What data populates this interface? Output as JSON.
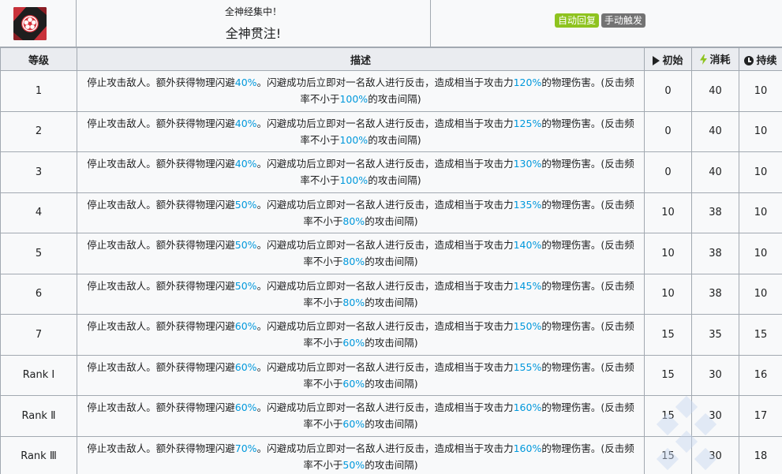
{
  "skill": {
    "icon": "skill-icon",
    "subtitle": "全神经集中！",
    "title": "全神贯注!",
    "tags": [
      {
        "label": "自动回复",
        "color": "#8ec31f"
      },
      {
        "label": "手动触发",
        "color": "#737373"
      }
    ]
  },
  "table": {
    "headers": {
      "level": "等级",
      "description": "描述",
      "initial": "初始",
      "cost": "消耗",
      "duration": "持续"
    },
    "desc_parts": {
      "a": "停止攻击敌人。额外获得物理闪避",
      "b": "。闪避成功后立即对一名敌人进行反击，造成相当于攻击力",
      "c": "的物理伤害。(反击频率不小于",
      "d": "的攻击间隔)"
    },
    "rows": [
      {
        "level": "1",
        "dodge": "40%",
        "atk": "120%",
        "freq": "100%",
        "initial": "0",
        "cost": "40",
        "duration": "10"
      },
      {
        "level": "2",
        "dodge": "40%",
        "atk": "125%",
        "freq": "100%",
        "initial": "0",
        "cost": "40",
        "duration": "10"
      },
      {
        "level": "3",
        "dodge": "40%",
        "atk": "130%",
        "freq": "100%",
        "initial": "0",
        "cost": "40",
        "duration": "10"
      },
      {
        "level": "4",
        "dodge": "50%",
        "atk": "135%",
        "freq": "80%",
        "initial": "10",
        "cost": "38",
        "duration": "10"
      },
      {
        "level": "5",
        "dodge": "50%",
        "atk": "140%",
        "freq": "80%",
        "initial": "10",
        "cost": "38",
        "duration": "10"
      },
      {
        "level": "6",
        "dodge": "50%",
        "atk": "145%",
        "freq": "80%",
        "initial": "10",
        "cost": "38",
        "duration": "10"
      },
      {
        "level": "7",
        "dodge": "60%",
        "atk": "150%",
        "freq": "60%",
        "initial": "15",
        "cost": "35",
        "duration": "15"
      },
      {
        "level": "Rank Ⅰ",
        "dodge": "60%",
        "atk": "155%",
        "freq": "60%",
        "initial": "15",
        "cost": "30",
        "duration": "16"
      },
      {
        "level": "Rank Ⅱ",
        "dodge": "60%",
        "atk": "160%",
        "freq": "60%",
        "initial": "15",
        "cost": "30",
        "duration": "17"
      },
      {
        "level": "Rank Ⅲ",
        "dodge": "70%",
        "atk": "160%",
        "freq": "50%",
        "initial": "15",
        "cost": "30",
        "duration": "18"
      }
    ]
  },
  "colors": {
    "highlight": "#0098dc",
    "header_bg": "#eaecf0",
    "border": "#a2a9b1",
    "cost_icon": "#8ec31f"
  }
}
